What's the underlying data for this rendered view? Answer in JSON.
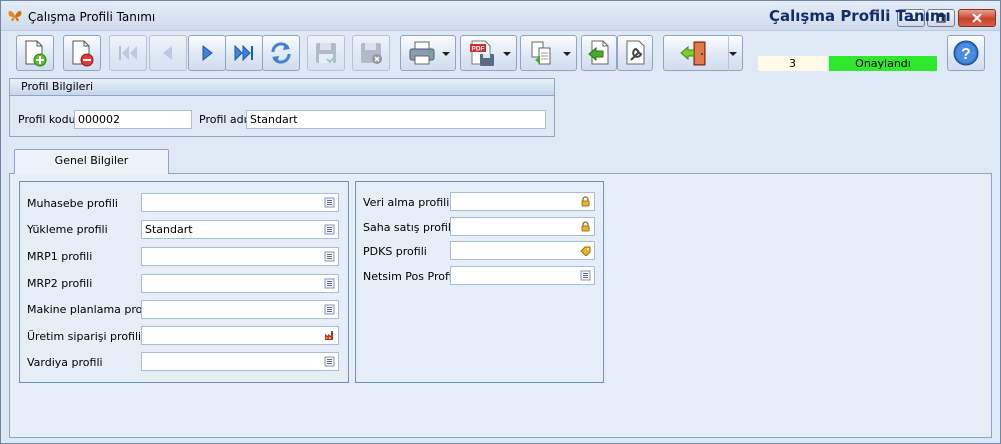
{
  "window": {
    "title": "Çalışma Profili Tanımı"
  },
  "header": {
    "form_title": "Çalışma Profili Tanımı",
    "record_count": "3",
    "status": "Onaylandı",
    "status_color": "#2ee82e"
  },
  "toolbar": {
    "buttons": [
      "new-record",
      "delete-record",
      "first-record",
      "previous-record",
      "next-record",
      "last-record",
      "refresh",
      "save",
      "cancel-save",
      "print",
      "export-pdf",
      "copy",
      "import",
      "settings",
      "exit",
      "help"
    ]
  },
  "profile_info": {
    "group_title": "Profil Bilgileri",
    "code_label": "Profil kodu",
    "code_value": "000002",
    "name_label": "Profil adı",
    "name_value": "Standart"
  },
  "tabs": [
    {
      "label": "Genel Bilgiler"
    }
  ],
  "general": {
    "left": [
      {
        "label": "Muhasebe profili",
        "value": "",
        "icon": "list-icon"
      },
      {
        "label": "Yükleme profili",
        "value": "Standart",
        "icon": "list-icon"
      },
      {
        "label": "MRP1 profili",
        "value": "",
        "icon": "list-icon"
      },
      {
        "label": "MRP2 profili",
        "value": "",
        "icon": "list-icon"
      },
      {
        "label": "Makine planlama profili",
        "value": "",
        "icon": "list-icon"
      },
      {
        "label": "Üretim siparişi profili",
        "value": "",
        "icon": "factory-icon"
      },
      {
        "label": "Vardiya profili",
        "value": "",
        "icon": "list-icon"
      }
    ],
    "right": [
      {
        "label": "Veri alma profili",
        "value": "",
        "icon": "lock-icon"
      },
      {
        "label": "Saha satış profili",
        "value": "",
        "icon": "lock-icon"
      },
      {
        "label": "PDKS profili",
        "value": "",
        "icon": "tag-icon"
      },
      {
        "label": "Netsim Pos Profili",
        "value": "",
        "icon": "list-icon"
      }
    ]
  }
}
